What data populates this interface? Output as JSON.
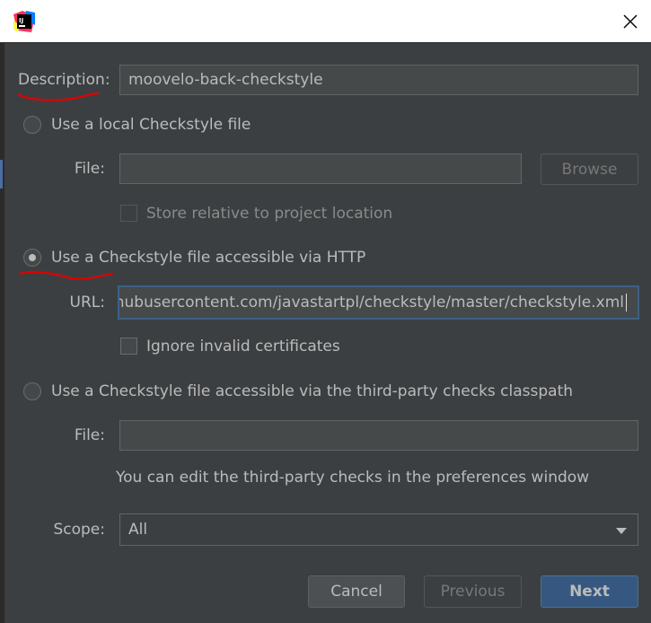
{
  "window": {
    "app_icon": "intellij-idea-icon",
    "close_icon": "close-icon"
  },
  "description": {
    "label": "Description:",
    "value": "moovelo-back-checkstyle"
  },
  "local_file": {
    "radio_label": "Use a local Checkstyle file",
    "file_label": "File:",
    "file_value": "",
    "browse_label": "Browse",
    "store_relative_label": "Store relative to project location"
  },
  "http_file": {
    "radio_label": "Use a Checkstyle file accessible via HTTP",
    "url_label": "URL:",
    "url_value": "w.githubusercontent.com/javastartpl/checkstyle/master/checkstyle.xml",
    "ignore_certs_label": "Ignore invalid certificates"
  },
  "classpath_file": {
    "radio_label": "Use a Checkstyle file accessible via the third-party checks classpath",
    "file_label": "File:",
    "file_value": "",
    "hint": "You can edit the third-party checks in the preferences window"
  },
  "scope": {
    "label": "Scope:",
    "value": "All"
  },
  "buttons": {
    "cancel": "Cancel",
    "previous": "Previous",
    "next": "Next"
  },
  "colors": {
    "background": "#3c3f41",
    "field": "#45494a",
    "accent": "#365880",
    "annotation": "#e00000"
  }
}
